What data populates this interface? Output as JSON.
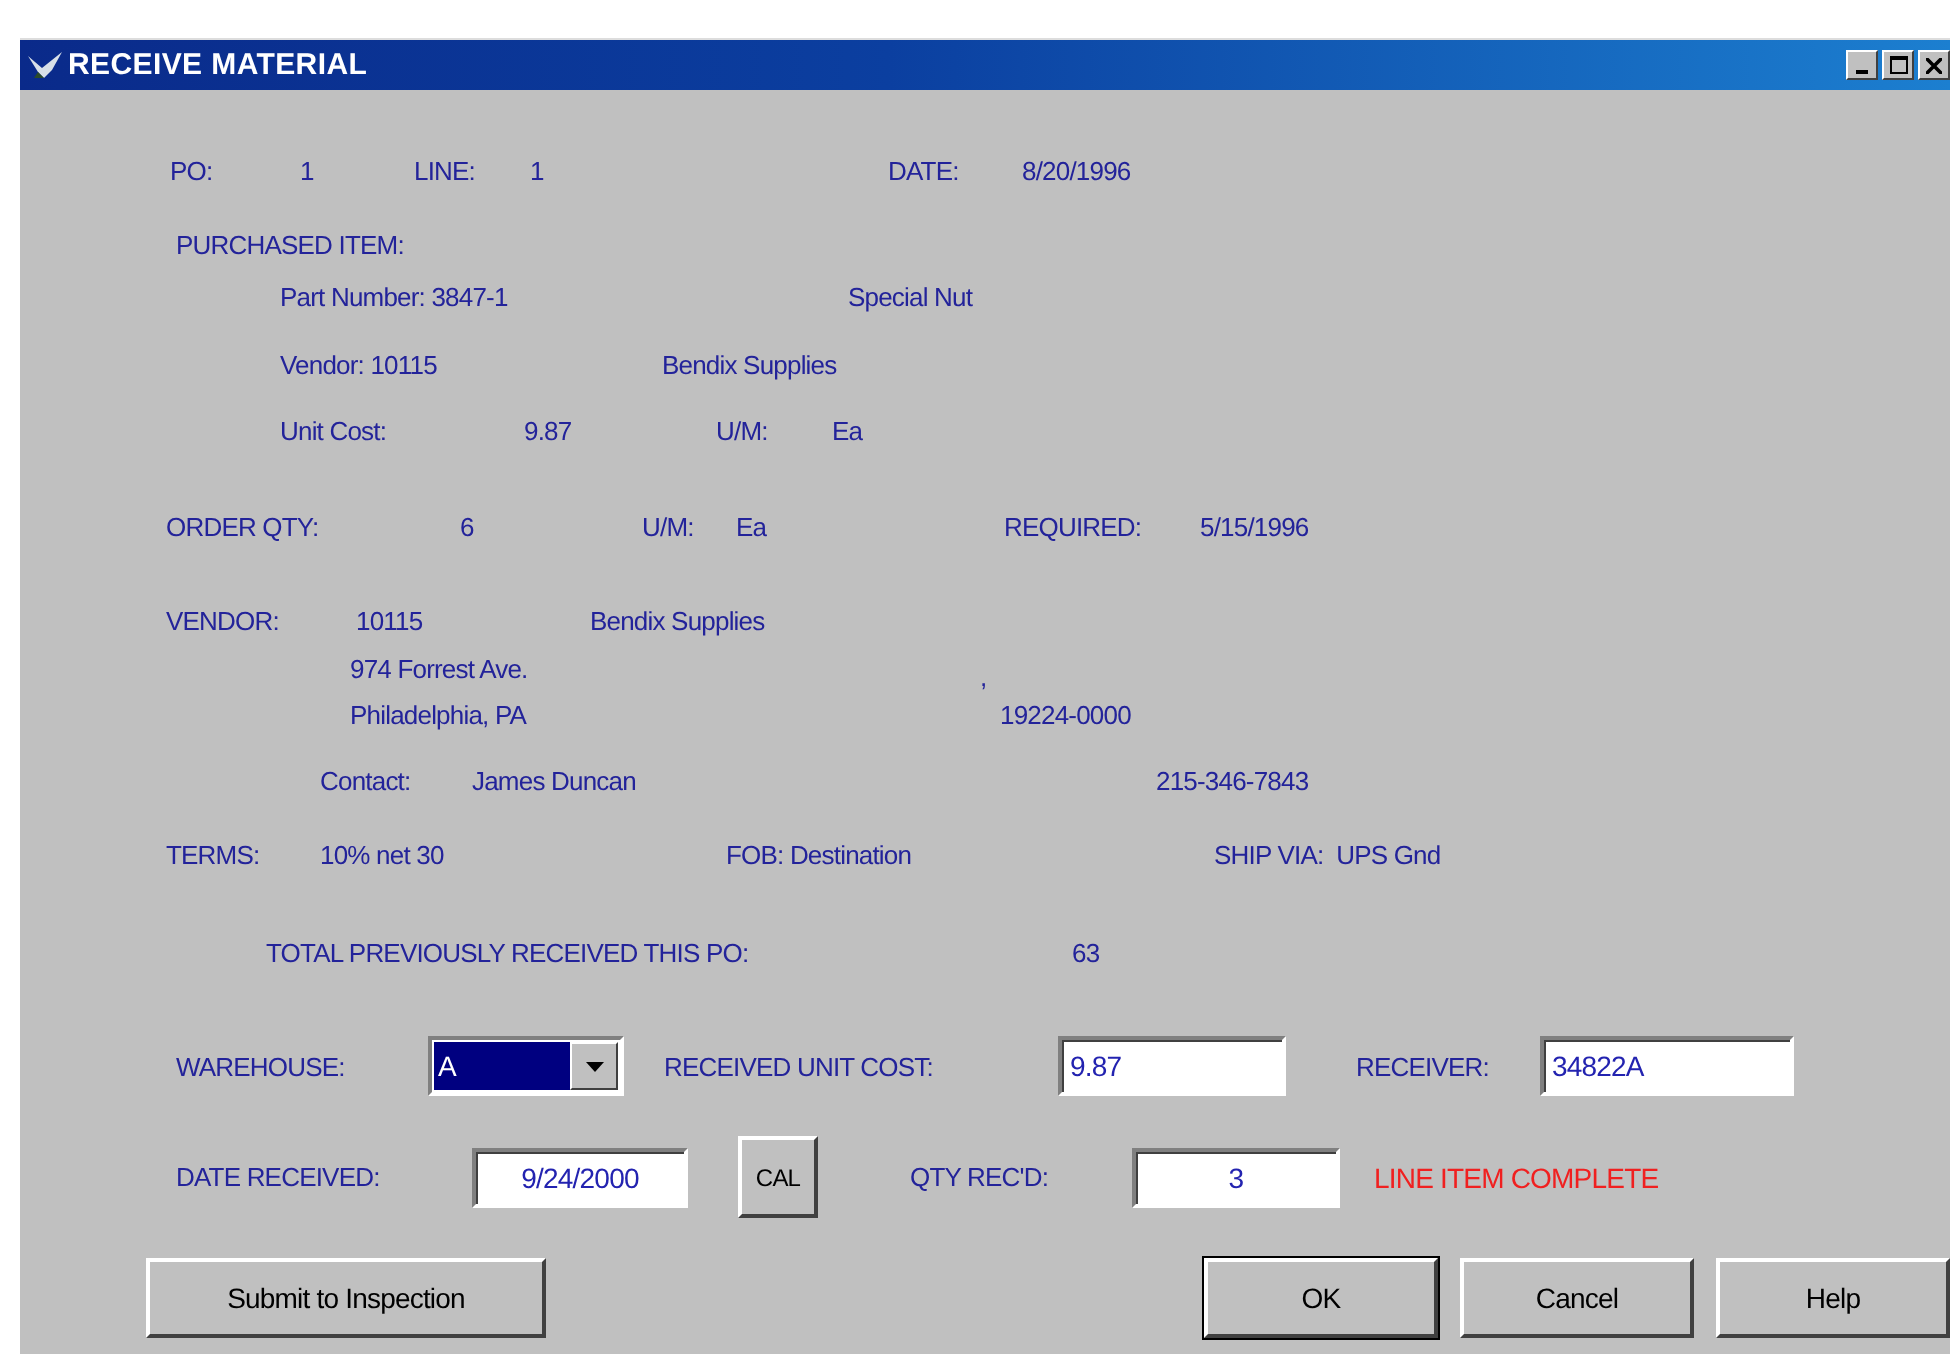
{
  "window": {
    "title": "RECEIVE MATERIAL"
  },
  "header": {
    "po_label": "PO:",
    "po": "1",
    "line_label": "LINE:",
    "line": "1",
    "date_label": "DATE:",
    "date": "8/20/1996"
  },
  "purchased_item": {
    "heading": "PURCHASED ITEM:",
    "part_number": "Part Number: 3847-1",
    "description": "Special Nut",
    "vendor": "Vendor: 10115",
    "vendor_name": "Bendix Supplies",
    "unit_cost_label": "Unit Cost:",
    "unit_cost": "9.87",
    "um_label": "U/M:",
    "um": "Ea"
  },
  "order": {
    "qty_label": "ORDER QTY:",
    "qty": "6",
    "um_label": "U/M:",
    "um": "Ea",
    "required_label": "REQUIRED:",
    "required": "5/15/1996"
  },
  "vendor": {
    "label": "VENDOR:",
    "id": "10115",
    "name": "Bendix Supplies",
    "address": "974 Forrest Ave.",
    "address_2": ",",
    "city": "Philadelphia, PA",
    "zip": "19224-0000",
    "contact_label": "Contact:",
    "contact": "James Duncan",
    "phone": "215-346-7843"
  },
  "terms": {
    "terms_label": "TERMS:",
    "terms": "10% net 30",
    "fob": "FOB: Destination",
    "ship_via": "SHIP VIA:  UPS Gnd"
  },
  "total": {
    "label": "TOTAL PREVIOUSLY RECEIVED THIS PO:",
    "value": "63"
  },
  "warehouse": {
    "label": "WAREHOUSE:",
    "value": "A",
    "highlighted": true
  },
  "received_unit_cost": {
    "label": "RECEIVED UNIT COST:",
    "value": "9.87"
  },
  "receiver": {
    "label": "RECEIVER:",
    "value": "34822A"
  },
  "date_received": {
    "label": "DATE RECEIVED:",
    "value": "9/24/2000"
  },
  "calendar_button": "CAL",
  "qty_received": {
    "label": "QTY REC'D:",
    "value": "3"
  },
  "status": "LINE ITEM COMPLETE",
  "submit_button": "Submit to Inspection",
  "buttons": [
    {
      "label": "OK",
      "default": true
    },
    {
      "label": "Cancel",
      "default": false
    },
    {
      "label": "Help",
      "default": false
    }
  ]
}
